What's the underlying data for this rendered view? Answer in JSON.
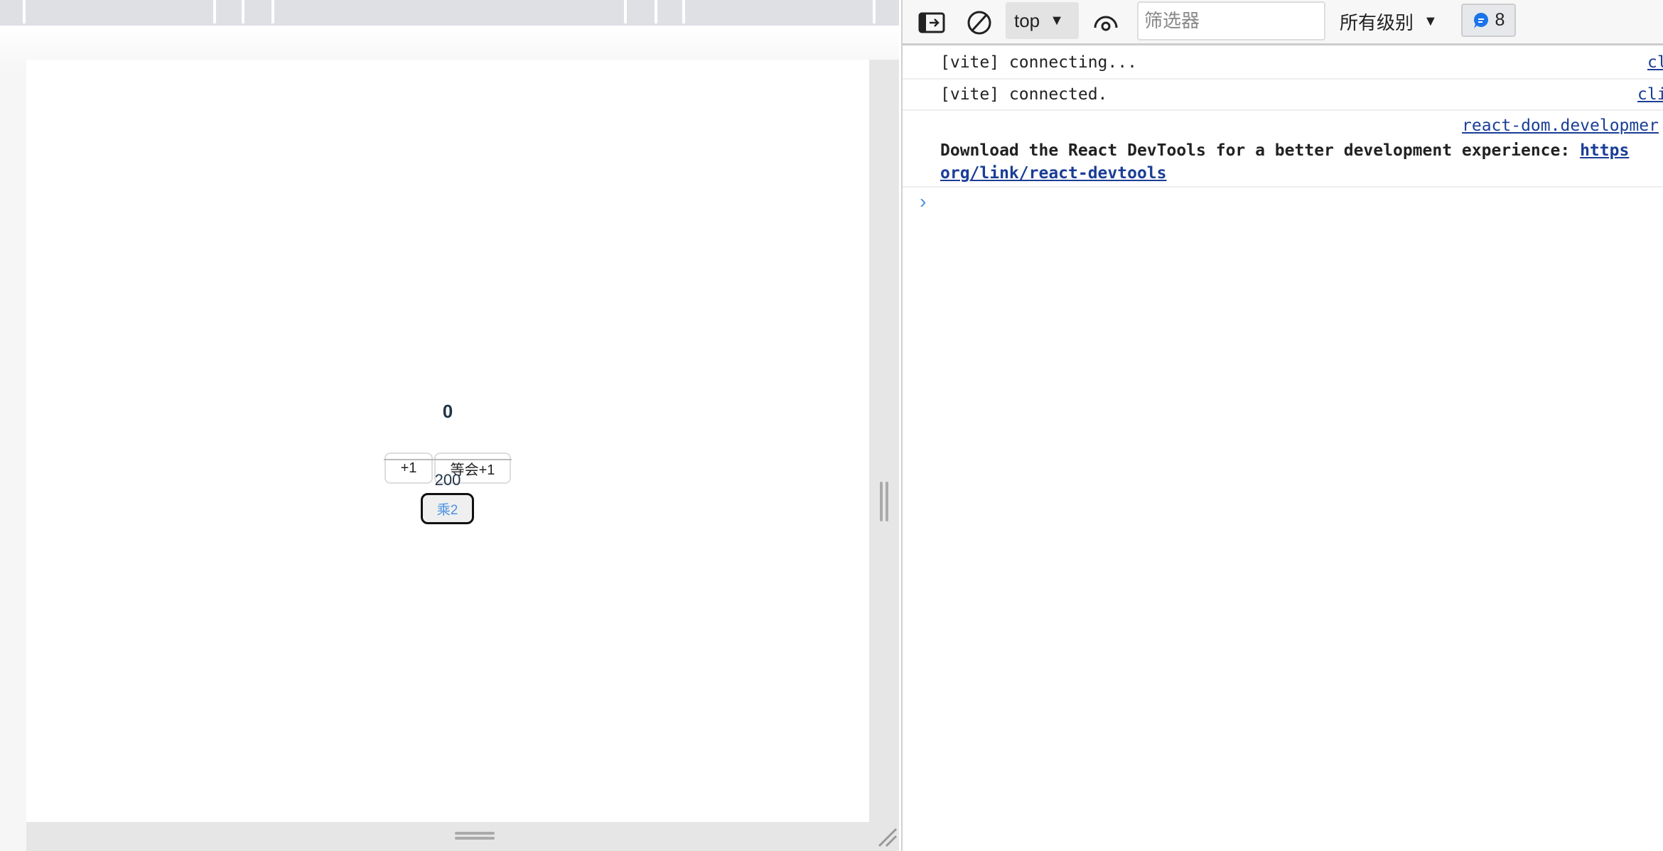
{
  "app": {
    "counter_value": "0",
    "buttons": {
      "increment": "+1",
      "delayed_increment": "等会+1",
      "multiply": "乘2"
    },
    "second_value": "200"
  },
  "devtools": {
    "toolbar": {
      "context": "top",
      "filter_placeholder": "筛选器",
      "filter_value": "",
      "levels": "所有级别",
      "message_count": "8",
      "icons": [
        "sidebar-toggle-icon",
        "clear-console-icon",
        "eye-icon",
        "message-icon"
      ]
    },
    "console": [
      {
        "message": "[vite] connecting...",
        "source": "cl"
      },
      {
        "message": "[vite] connected.",
        "source": "cli"
      },
      {
        "message": "Download the React DevTools for a better development experience: ",
        "link": "https",
        "link2": "org/link/react-devtools",
        "source": "react-dom.developmer"
      }
    ],
    "accent": "#1a73e8"
  }
}
